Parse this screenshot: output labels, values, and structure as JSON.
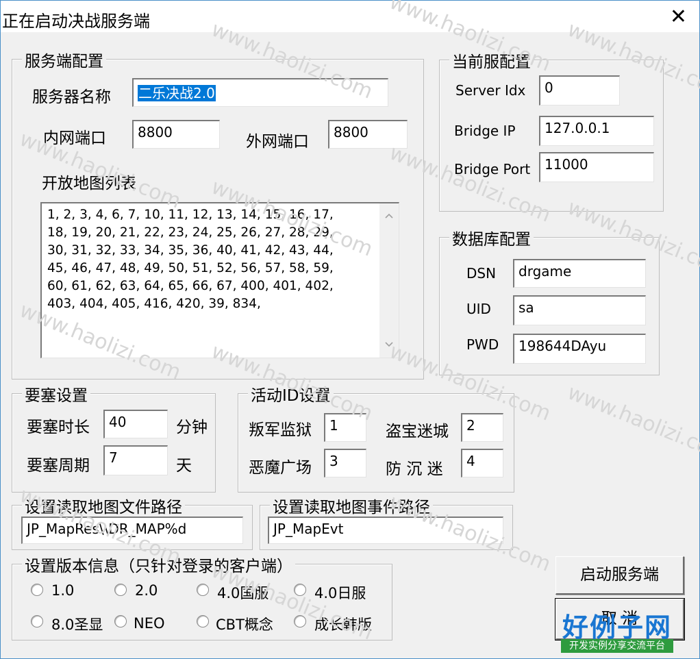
{
  "window": {
    "title": "正在启动决战服务端",
    "close_glyph": "✕"
  },
  "server_config": {
    "group_label": "服务端配置",
    "server_name_label": "服务器名称",
    "server_name_value": "二乐决战2.0",
    "lan_port_label": "内网端口",
    "lan_port_value": "8800",
    "wan_port_label": "外网端口",
    "wan_port_value": "8800",
    "map_list_label": "开放地图列表",
    "map_list_lines": [
      "1, 2, 3, 4, 6, 7, 10, 11, 12, 13, 14, 15, 16, 17,",
      "18, 19, 20, 21, 22, 23, 24, 25, 26, 27, 28, 29,",
      "30, 31, 32, 33, 34, 35, 36, 40, 41, 42, 43, 44,",
      "45, 46, 47, 48, 49, 50, 51, 52, 56, 57, 58, 59,",
      "60, 61, 62, 63, 64, 65, 66, 67, 400, 401, 402,",
      "403, 404, 405, 416, 420, 39, 834,"
    ]
  },
  "current_server": {
    "group_label": "当前服配置",
    "server_idx_label": "Server Idx",
    "server_idx_value": "0",
    "bridge_ip_label": "Bridge IP",
    "bridge_ip_value": "127.0.0.1",
    "bridge_port_label": "Bridge Port",
    "bridge_port_value": "11000"
  },
  "database": {
    "group_label": "数据库配置",
    "dsn_label": "DSN",
    "dsn_value": "drgame",
    "uid_label": "UID",
    "uid_value": "sa",
    "pwd_label": "PWD",
    "pwd_value": "198644DAyu"
  },
  "fortress": {
    "group_label": "要塞设置",
    "duration_label": "要塞时长",
    "duration_value": "40",
    "duration_unit": "分钟",
    "period_label": "要塞周期",
    "period_value": "7",
    "period_unit": "天"
  },
  "activity": {
    "group_label": "活动ID设置",
    "rebel_prison_label": "叛军监狱",
    "rebel_prison_value": "1",
    "treasure_maze_label": "盗宝迷城",
    "treasure_maze_value": "2",
    "demon_square_label": "恶魔广场",
    "demon_square_value": "3",
    "fangchenmi_label": "防 沉 迷",
    "fangchenmi_value": "4"
  },
  "map_file_path": {
    "group_label": "设置读取地图文件路径",
    "value": "JP_MapRes\\\\DR_MAP%d"
  },
  "map_event_path": {
    "group_label": "设置读取地图事件路径",
    "value": "JP_MapEvt"
  },
  "version": {
    "group_label": "设置版本信息（只针对登录的客户端）",
    "options": [
      "1.0",
      "2.0",
      "4.0国服",
      "4.0日服",
      "8.0圣显",
      "NEO",
      "CBT概念",
      "成长韩版"
    ]
  },
  "buttons": {
    "start_label": "启动服务端",
    "cancel_label": "取 消"
  },
  "watermark": {
    "text": "www.haolizi.com",
    "logo_main": "好例子网",
    "logo_sub": "开发实例分享交流平台"
  }
}
